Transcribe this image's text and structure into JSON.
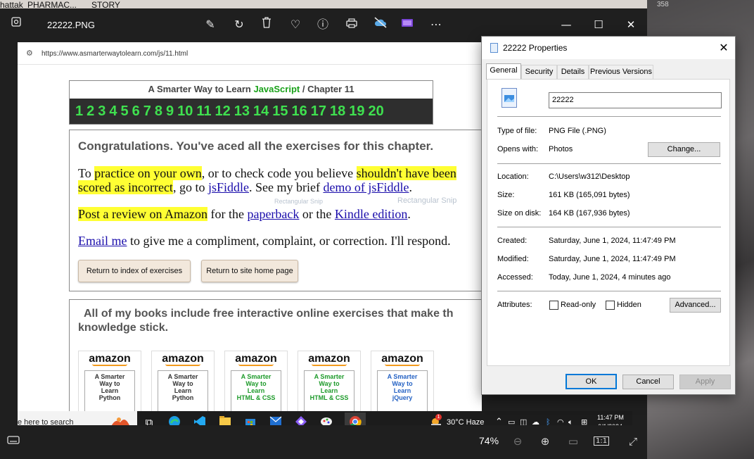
{
  "background": {
    "top_labels": [
      "hattak",
      "PHARMAC...",
      "STORY"
    ],
    "right_number": "358"
  },
  "photos": {
    "filename": "22222.PNG",
    "zoom": "74%",
    "toolbar_icons": [
      "edit-icon",
      "rotate-icon",
      "delete-icon",
      "favorite-icon",
      "info-icon",
      "print-icon",
      "cloud-off-icon",
      "video-editor-icon",
      "more-icon"
    ]
  },
  "webpage": {
    "url": "https://www.asmarterwaytolearn.com/js/11.html",
    "chapter_title_pre": "A Smarter Way to Learn ",
    "chapter_title_js": "JavaScript",
    "chapter_title_post": " / Chapter 11",
    "chapters": [
      "1",
      "2",
      "3",
      "4",
      "5",
      "6",
      "7",
      "8",
      "9",
      "10",
      "11",
      "12",
      "13",
      "14",
      "15",
      "16",
      "17",
      "18",
      "19",
      "20"
    ],
    "congrats": "Congratulations. You've aced all the exercises for this chapter.",
    "p1": {
      "a": "To ",
      "b": "practice on your own",
      "c": ", or to check code you believe ",
      "d": "shouldn't have been",
      "e": "scored as incorrect",
      "f": ", go to ",
      "g": "jsFiddle",
      "h": ". See my brief ",
      "i": "demo of jsFiddle",
      "j": "."
    },
    "p2": {
      "a": "Post a review on Amazon",
      "b": " for the ",
      "c": "paperback",
      "d": " or the ",
      "e": "Kindle edition",
      "f": "."
    },
    "p3": {
      "a": "Email me",
      "b": " to give me a compliment, complaint, or correction. I'll respond."
    },
    "btn_index": "Return to index of exercises",
    "btn_home": "Return to site home page",
    "books_text_1": "All of my books include free interactive online exercises that make th",
    "books_text_2": "knowledge stick.",
    "faint_1": "Rectangular Snip",
    "faint_2": "Rectangular Snip",
    "books": [
      {
        "brand": "amazon",
        "l1": "A Smarter",
        "l2": "Way to",
        "l3": "Learn",
        "l4": "Python",
        "color": "#333333"
      },
      {
        "brand": "amazon",
        "l1": "A Smarter",
        "l2": "Way to",
        "l3": "Learn",
        "l4": "Python",
        "color": "#333333"
      },
      {
        "brand": "amazon",
        "l1": "A Smarter",
        "l2": "Way to",
        "l3": "Learn",
        "l4": "HTML & CSS",
        "color": "#1d9a2a"
      },
      {
        "brand": "amazon",
        "l1": "A Smarter",
        "l2": "Way to",
        "l3": "Learn",
        "l4": "HTML & CSS",
        "color": "#1d9a2a"
      },
      {
        "brand": "amazon",
        "l1": "A Smarter",
        "l2": "Way to",
        "l3": "Learn",
        "l4": "jQuery",
        "color": "#2663c4"
      }
    ]
  },
  "taskbar": {
    "search_text": "e here to search",
    "weather": "30°C  Haze",
    "time": "11:47 PM",
    "date": "6/1/2024",
    "weather_badge": "1"
  },
  "properties": {
    "title": "22222 Properties",
    "tabs": [
      "General",
      "Security",
      "Details",
      "Previous Versions"
    ],
    "name_value": "22222",
    "type_label": "Type of file:",
    "type_value": "PNG File (.PNG)",
    "opens_label": "Opens with:",
    "opens_value": "Photos",
    "change_btn": "Change...",
    "location_label": "Location:",
    "location_value": "C:\\Users\\w312\\Desktop",
    "size_label": "Size:",
    "size_value": "161 KB (165,091 bytes)",
    "sod_label": "Size on disk:",
    "sod_value": "164 KB (167,936 bytes)",
    "created_label": "Created:",
    "created_value": "Saturday, June 1, 2024, 11:47:49 PM",
    "modified_label": "Modified:",
    "modified_value": "Saturday, June 1, 2024, 11:47:49 PM",
    "accessed_label": "Accessed:",
    "accessed_value": "Today, June 1, 2024, 4 minutes ago",
    "attributes_label": "Attributes:",
    "readonly_label": "Read-only",
    "hidden_label": "Hidden",
    "advanced_btn": "Advanced...",
    "ok_btn": "OK",
    "cancel_btn": "Cancel",
    "apply_btn": "Apply"
  },
  "colors": {
    "highlight": "#ffff33",
    "chapter_green": "#3fe04f",
    "link": "#1a0dab",
    "ok_border": "#0078d7"
  }
}
